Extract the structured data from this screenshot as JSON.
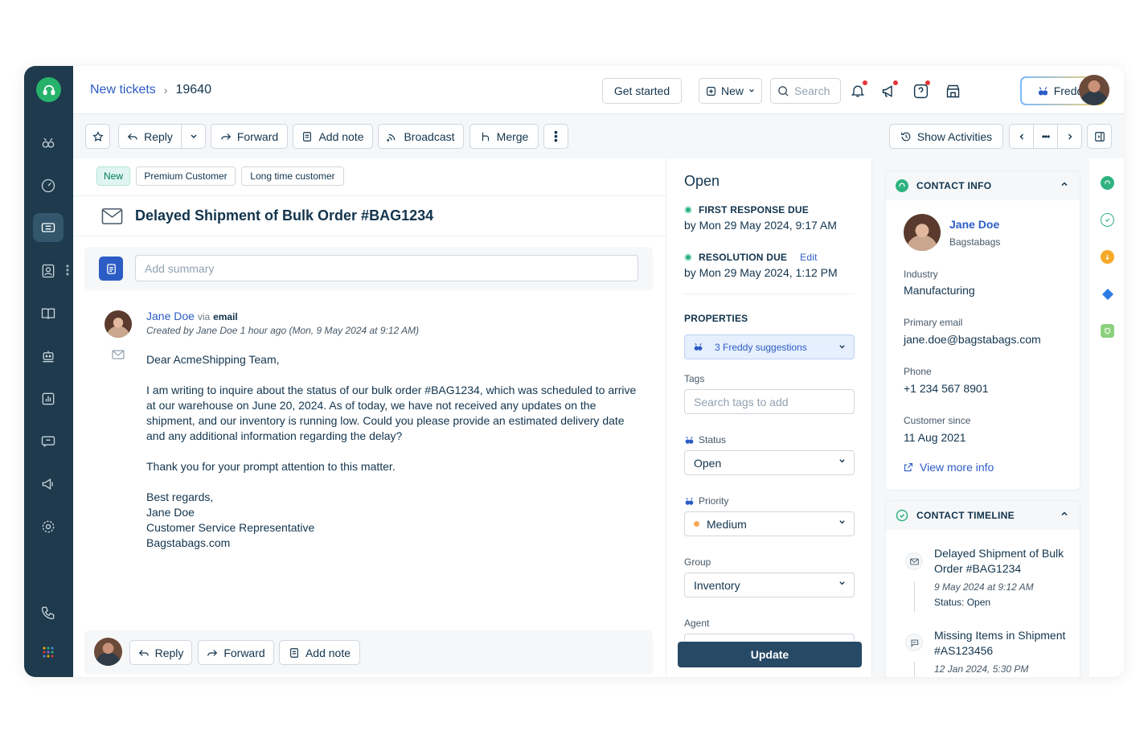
{
  "breadcrumb": {
    "parent": "New tickets",
    "current": "19640"
  },
  "topbar": {
    "get_started": "Get started",
    "new_label": "New",
    "search_placeholder": "Search",
    "freddy_label": "Freddy"
  },
  "toolbar": {
    "reply": "Reply",
    "forward": "Forward",
    "add_note": "Add note",
    "broadcast": "Broadcast",
    "merge": "Merge",
    "show_activities": "Show Activities"
  },
  "tags": [
    "New",
    "Premium Customer",
    "Long time customer"
  ],
  "ticket": {
    "subject": "Delayed Shipment of Bulk Order #BAG1234",
    "summary_placeholder": "Add summary"
  },
  "message": {
    "sender": "Jane Doe",
    "via": "via",
    "channel": "email",
    "meta": "Created by Jane Doe  1 hour ago (Mon, 9 May 2024 at 9:12 AM)",
    "greeting": "Dear AcmeShipping Team,",
    "para1": "I am writing to inquire about the status of our bulk order #BAG1234, which was scheduled to arrive at our warehouse on June 20, 2024. As of today, we have not received any updates on the shipment, and our inventory is running low. Could you please provide an estimated delivery date and any additional information regarding the delay?",
    "para2": "Thank you for your prompt attention to this matter.",
    "sign1": "Best regards,",
    "sign2": "Jane Doe",
    "sign3": "Customer Service Representative",
    "sign4": "Bagstabags.com"
  },
  "reply_bar": {
    "reply": "Reply",
    "forward": "Forward",
    "add_note": "Add note"
  },
  "status_panel": {
    "state": "Open",
    "first_response_label": "FIRST RESPONSE DUE",
    "first_response_value": "by Mon 29 May 2024, 9:17 AM",
    "resolution_label": "RESOLUTION DUE",
    "resolution_edit": "Edit",
    "resolution_value": "by Mon 29 May 2024, 1:12 PM",
    "properties_label": "PROPERTIES",
    "freddy_suggestions": "3 Freddy suggestions",
    "tags_label": "Tags",
    "tags_placeholder": "Search tags to add",
    "status_label": "Status",
    "status_value": "Open",
    "priority_label": "Priority",
    "priority_value": "Medium",
    "group_label": "Group",
    "group_value": "Inventory",
    "agent_label": "Agent",
    "update": "Update"
  },
  "contact": {
    "header": "CONTACT INFO",
    "name": "Jane Doe",
    "company": "Bagstabags",
    "industry_label": "Industry",
    "industry": "Manufacturing",
    "email_label": "Primary email",
    "email": "jane.doe@bagstabags.com",
    "phone_label": "Phone",
    "phone": "+1 234 567 8901",
    "since_label": "Customer since",
    "since": "11 Aug 2021",
    "view_more": "View more info"
  },
  "timeline": {
    "header": "CONTACT TIMELINE",
    "items": [
      {
        "title": "Delayed Shipment of Bulk Order #BAG1234",
        "date": "9 May 2024 at 9:12 AM",
        "status": "Status: Open"
      },
      {
        "title": "Missing Items in Shipment #AS123456",
        "date": "12 Jan 2024, 5:30 PM"
      }
    ]
  },
  "colors": {
    "sidebar": "#1e3a4c",
    "link": "#2c5cc5",
    "update_button": "#264966",
    "success": "#2fb380",
    "priority_medium": "#f5a857"
  }
}
